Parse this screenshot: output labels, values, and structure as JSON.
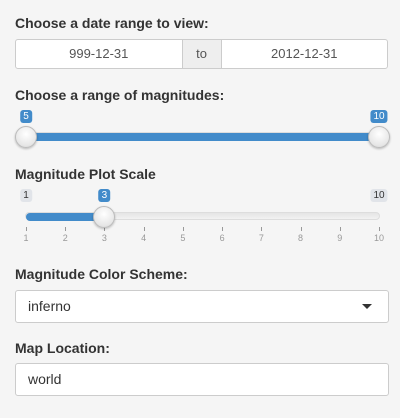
{
  "date_range": {
    "label": "Choose a date range to view:",
    "start": "999-12-31",
    "separator": "to",
    "end": "2012-12-31"
  },
  "magnitude_range": {
    "label": "Choose a range of magnitudes:",
    "min": 5,
    "max": 10,
    "from": 5,
    "to": 10,
    "from_label": "5",
    "to_label": "10",
    "accent": "#428bca"
  },
  "plot_scale": {
    "label": "Magnitude Plot Scale",
    "min": 1,
    "max": 10,
    "value": 3,
    "min_label": "1",
    "max_label": "10",
    "value_label": "3",
    "grid_labels": [
      "1",
      "2",
      "3",
      "4",
      "5",
      "6",
      "7",
      "8",
      "9",
      "10"
    ]
  },
  "color_scheme": {
    "label": "Magnitude Color Scheme:",
    "selected": "inferno",
    "icon": "caret-down-icon"
  },
  "map_location": {
    "label": "Map Location:",
    "value": "world"
  }
}
